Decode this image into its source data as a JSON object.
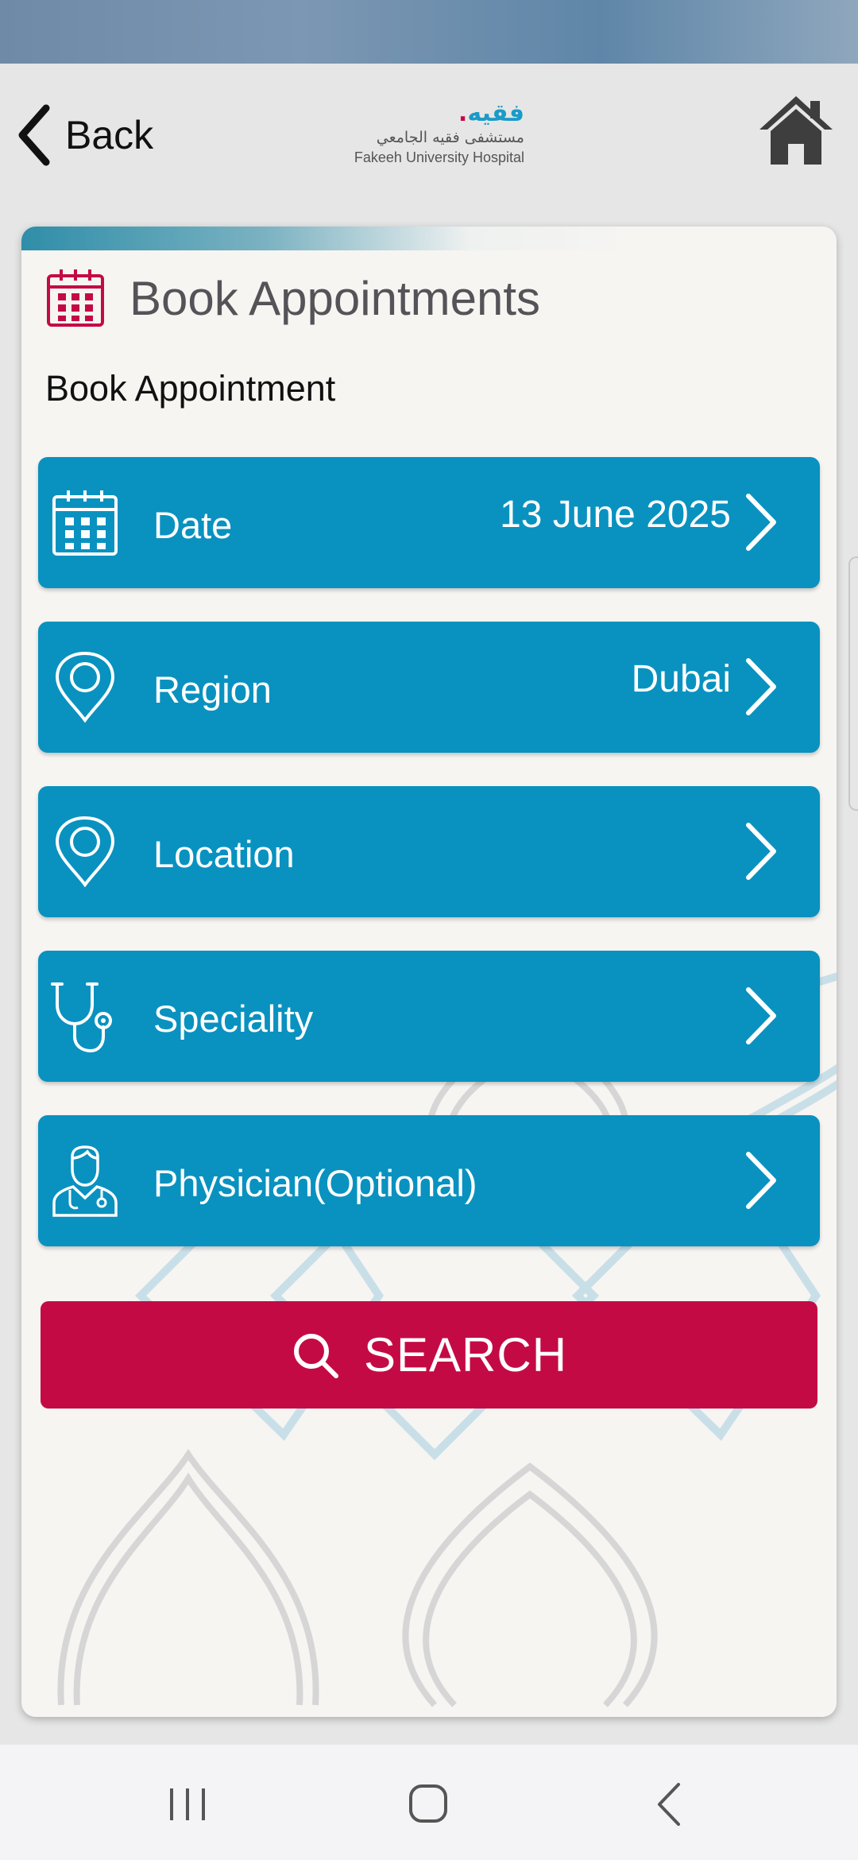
{
  "header": {
    "back_label": "Back",
    "logo": {
      "brand_arabic": "فقيه",
      "name_arabic": "مستشفى فقيه الجامعي",
      "name_english": "Fakeeh University Hospital"
    }
  },
  "card": {
    "title": "Book Appointments",
    "subtitle": "Book Appointment"
  },
  "rows": [
    {
      "label": "Date",
      "value": "13 June 2025",
      "icon": "calendar-icon"
    },
    {
      "label": "Region",
      "value": "Dubai",
      "icon": "location-pin-icon"
    },
    {
      "label": "Location",
      "value": "",
      "icon": "location-pin-icon"
    },
    {
      "label": "Speciality",
      "value": "",
      "icon": "stethoscope-icon"
    },
    {
      "label": "Physician(Optional)",
      "value": "",
      "icon": "doctor-icon"
    }
  ],
  "search": {
    "label": "SEARCH",
    "icon": "search-icon"
  },
  "colors": {
    "row_blue": "#0992c0",
    "accent_red": "#c40a45",
    "title_gray": "#545458",
    "background": "#e6e6e6",
    "card_bg": "#f6f5f2"
  }
}
